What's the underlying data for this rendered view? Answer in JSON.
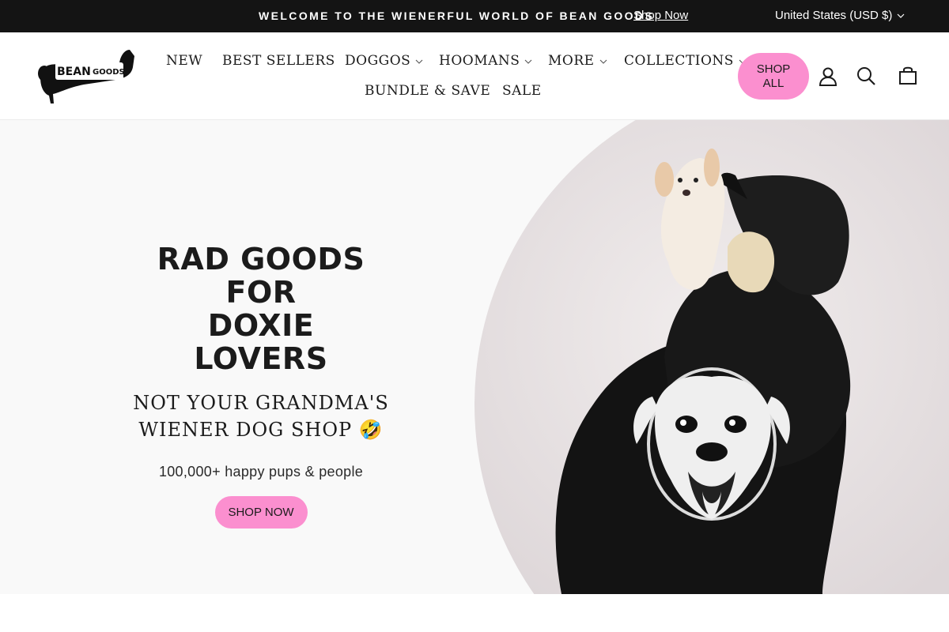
{
  "announcement": {
    "message": "WELCOME TO THE WIENERFUL WORLD OF BEAN GOODS",
    "link_label": "Shop Now",
    "currency": "United States (USD $)"
  },
  "header": {
    "logo_text": "BEAN GOODS",
    "nav": [
      {
        "label": "NEW"
      },
      {
        "label": "BEST SELLERS"
      },
      {
        "label": "DOGGOS"
      },
      {
        "label": "HOOMANS"
      },
      {
        "label": "MORE"
      },
      {
        "label": "COLLECTIONS"
      },
      {
        "label": "BUNDLE & SAVE"
      },
      {
        "label": "SALE"
      }
    ],
    "shop_all_label": "SHOP ALL",
    "icons": [
      "account-icon",
      "search-icon",
      "cart-icon"
    ]
  },
  "hero": {
    "title_line1": "RAD GOODS FOR",
    "title_line2": "DOXIE LOVERS",
    "subtitle_line1": "NOT YOUR GRANDMA'S",
    "subtitle_line2": "WIENER DOG SHOP 🤣",
    "stat": "100,000+ happy pups & people",
    "cta_label": "SHOP NOW"
  },
  "colors": {
    "topbar": "#141414",
    "accent_pink": "#fb8fcf",
    "hero_bg": "#f9f9f9"
  }
}
